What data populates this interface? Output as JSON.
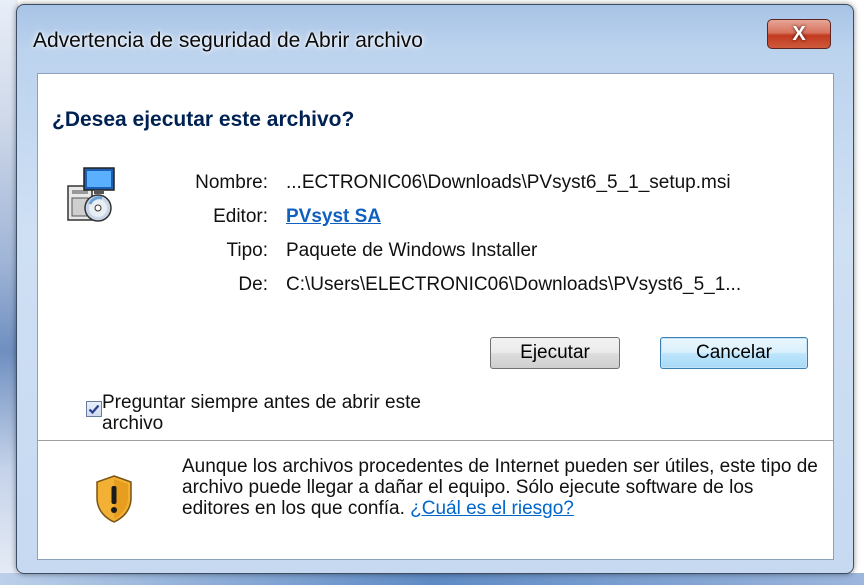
{
  "window": {
    "title": "Advertencia de seguridad de Abrir archivo",
    "close_glyph": "X"
  },
  "dialog": {
    "question": "¿Desea ejecutar este archivo?",
    "file_icon": "installer-package-icon",
    "fields": [
      {
        "label": "Nombre:",
        "value": "...ECTRONIC06\\Downloads\\PVsyst6_5_1_setup.msi"
      },
      {
        "label": "Editor:",
        "value": "PVsyst SA"
      },
      {
        "label": "Tipo:",
        "value": "Paquete de Windows Installer"
      },
      {
        "label": "De:",
        "value": "C:\\Users\\ELECTRONIC06\\Downloads\\PVsyst6_5_1..."
      }
    ],
    "buttons": {
      "run": "Ejecutar",
      "cancel": "Cancelar"
    },
    "checkbox": {
      "checked": true,
      "label_line1": "Preguntar siempre antes de abrir este",
      "label_line2": "archivo"
    },
    "warning": {
      "icon": "shield-warning-icon",
      "text": "Aunque los archivos procedentes de Internet pueden ser útiles, este tipo de archivo puede llegar a dañar el equipo. Sólo ejecute software de los editores en los que confía.",
      "link": "¿Cuál es el riesgo?"
    }
  },
  "colors": {
    "question": "#002253",
    "link": "#1060c0",
    "close_button": "#c13a20"
  }
}
